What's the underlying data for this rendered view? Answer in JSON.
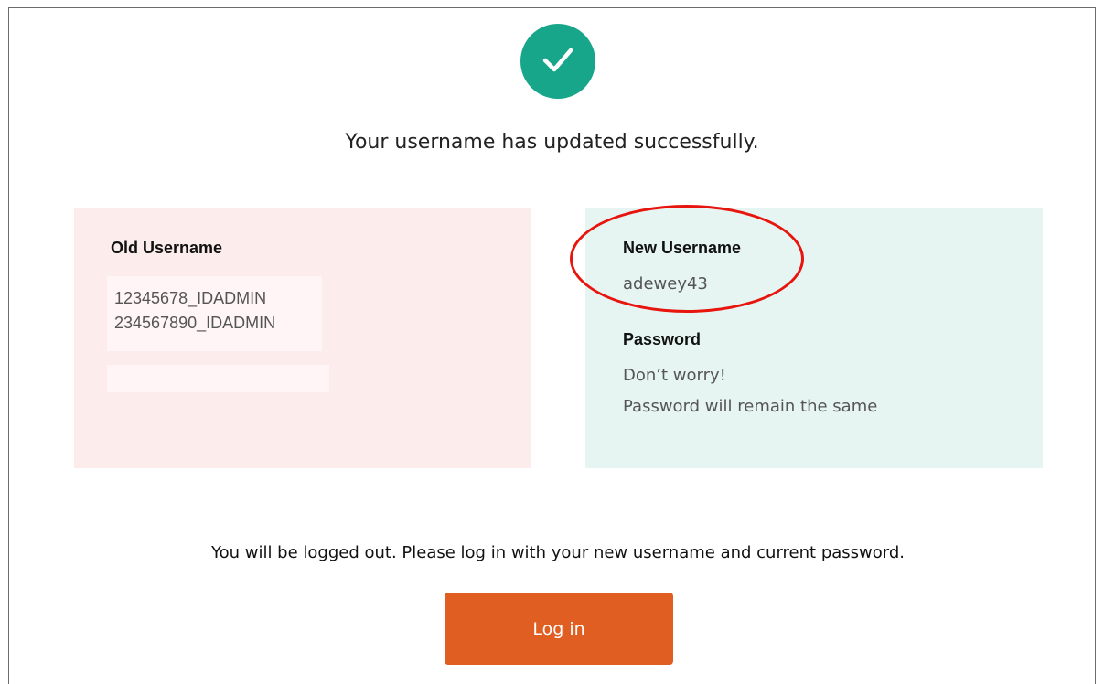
{
  "confirmation": {
    "icon": "check-icon",
    "message": "Your username has updated successfully."
  },
  "old_panel": {
    "heading": "Old Username",
    "usernames": [
      "12345678_IDADMIN",
      "234567890_IDADMIN"
    ],
    "background": "#fcecec"
  },
  "new_panel": {
    "heading": "New Username",
    "username": "adewey43",
    "password_heading": "Password",
    "password_lines": [
      "Don’t worry!",
      "Password will remain the same"
    ],
    "background": "#e6f5f1"
  },
  "notice": "You will be logged out. Please log in with your new username and current password.",
  "login_button": {
    "label": "Log in",
    "color": "#e05e22"
  },
  "colors": {
    "success": "#17a68a",
    "annotation": "#e8150f"
  }
}
